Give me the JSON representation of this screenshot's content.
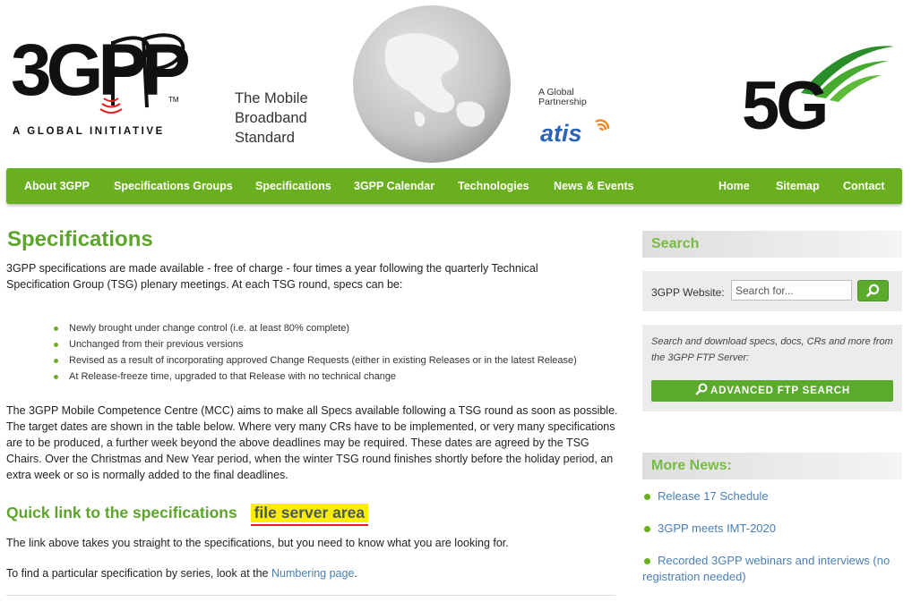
{
  "header": {
    "logo_text": "3GPP",
    "logo_tagline": "A GLOBAL INITIATIVE",
    "tagline_lines": [
      "The Mobile",
      "Broadband",
      "Standard"
    ],
    "partner_label_lines": [
      "A Global",
      "Partnership"
    ],
    "partner_logo": "atis",
    "logo_5g": "5G"
  },
  "nav": {
    "left": [
      "About 3GPP",
      "Specifications Groups",
      "Specifications",
      "3GPP Calendar",
      "Technologies",
      "News & Events"
    ],
    "right": [
      "Home",
      "Sitemap",
      "Contact"
    ]
  },
  "main": {
    "title": "Specifications",
    "intro": "3GPP specifications are made available - free of charge - four times a year following the quarterly Technical Specification Group (TSG) plenary meetings. At each TSG round, specs can be:",
    "bullets": [
      "Newly brought under change control (i.e. at least 80% complete)",
      "Unchanged from their previous versions",
      "Revised as a result of incorporating approved Change Requests (either in existing Releases or in the latest Release)",
      "At Release-freeze time, upgraded to that Release with no technical change"
    ],
    "mcc_paragraph": "The 3GPP Mobile Competence Centre (MCC) aims to make all Specs available following a TSG round as soon as possible. The target dates are shown in the table below. Where very many CRs have to be implemented, or very many specifications are to be produced, a further week beyond the above deadlines may be required. These dates are agreed by the TSG Chairs. Over the Christmas and New Year period, when the winter TSG round finishes shortly before the holiday period, an extra week or so is normally added to the final deadlines.",
    "quick_link_prefix": "Quick link to the specifications",
    "quick_link_text": "file server area",
    "link_paragraph": "The link above takes you straight to the specifications, but you need to know what you are looking for.",
    "find_prefix": "To find a particular specification by series, look at the ",
    "find_link": "Numbering page",
    "find_suffix": "."
  },
  "sidebar": {
    "search_heading": "Search",
    "search_label": "3GPP Website:",
    "search_placeholder": "Search for...",
    "ftp_text": "Search and download specs, docs, CRs and more from the 3GPP FTP Server:",
    "ftp_button": "ADVANCED FTP SEARCH",
    "news_heading": "More News:",
    "news": [
      "Release 17 Schedule",
      "3GPP meets IMT-2020",
      "Recorded 3GPP webinars and interviews (no registration needed)"
    ]
  },
  "colors": {
    "brand_green": "#6aaf1f",
    "heading_green": "#5ca52a",
    "link_blue": "#4a7fb3",
    "highlight_yellow": "#ffee00",
    "underline_red": "#e02020"
  }
}
